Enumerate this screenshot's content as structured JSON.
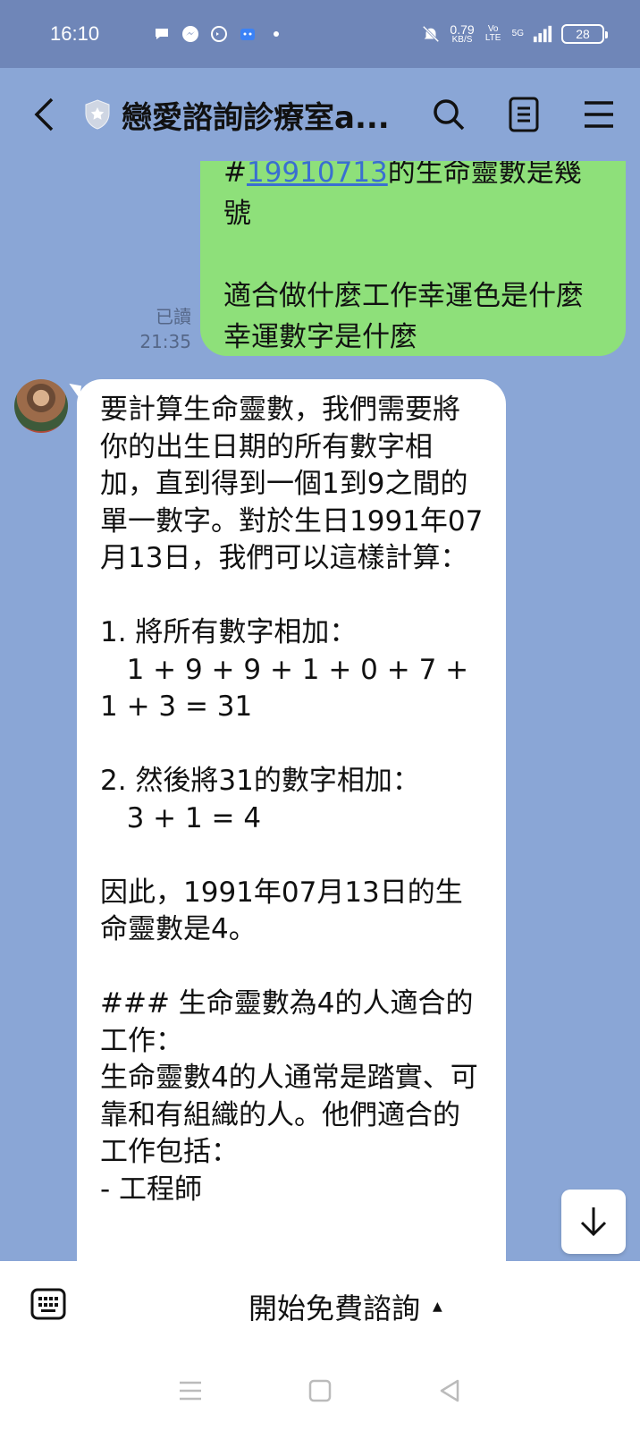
{
  "status_bar": {
    "time": "16:10",
    "net_speed_value": "0.79",
    "net_speed_unit": "KB/S",
    "volte": "Vo LTE",
    "signal": "5G",
    "battery": "28",
    "notification_icons": [
      "chat-bubble-icon",
      "messenger-icon",
      "sync-icon",
      "android-icon",
      "dot-icon"
    ]
  },
  "header": {
    "title": "戀愛諮詢診療室a..."
  },
  "messages": [
    {
      "direction": "outgoing",
      "hashtag_prefix": "#",
      "hashtag_link": "19910713",
      "text_after_link": "的生命靈數是幾號\n\n適合做什麼工作幸運色是什麼幸運數字是什麼",
      "read_label": "已讀",
      "time": "21:35"
    },
    {
      "direction": "incoming",
      "text": "要計算生命靈數，我們需要將你的出生日期的所有數字相加，直到得到一個1到9之間的單一數字。對於生日1991年07月13日，我們可以這樣計算：\n\n1. 將所有數字相加：\n   1 + 9 + 9 + 1 + 0 + 7 + 1 + 3 = 31\n\n2. 然後將31的數字相加：\n   3 + 1 = 4\n\n因此，1991年07月13日的生命靈數是4。\n\n### 生命靈數為4的人適合的工作：\n生命靈數4的人通常是踏實、可靠和有組織的人。他們適合的工作包括：\n- 工程師"
    }
  ],
  "input_bar": {
    "start_label": "開始免費諮詢"
  },
  "colors": {
    "chat_background": "#8aa6d6",
    "outgoing_bubble": "#8ee07a",
    "incoming_bubble": "#ffffff",
    "link": "#3a6fd1"
  }
}
